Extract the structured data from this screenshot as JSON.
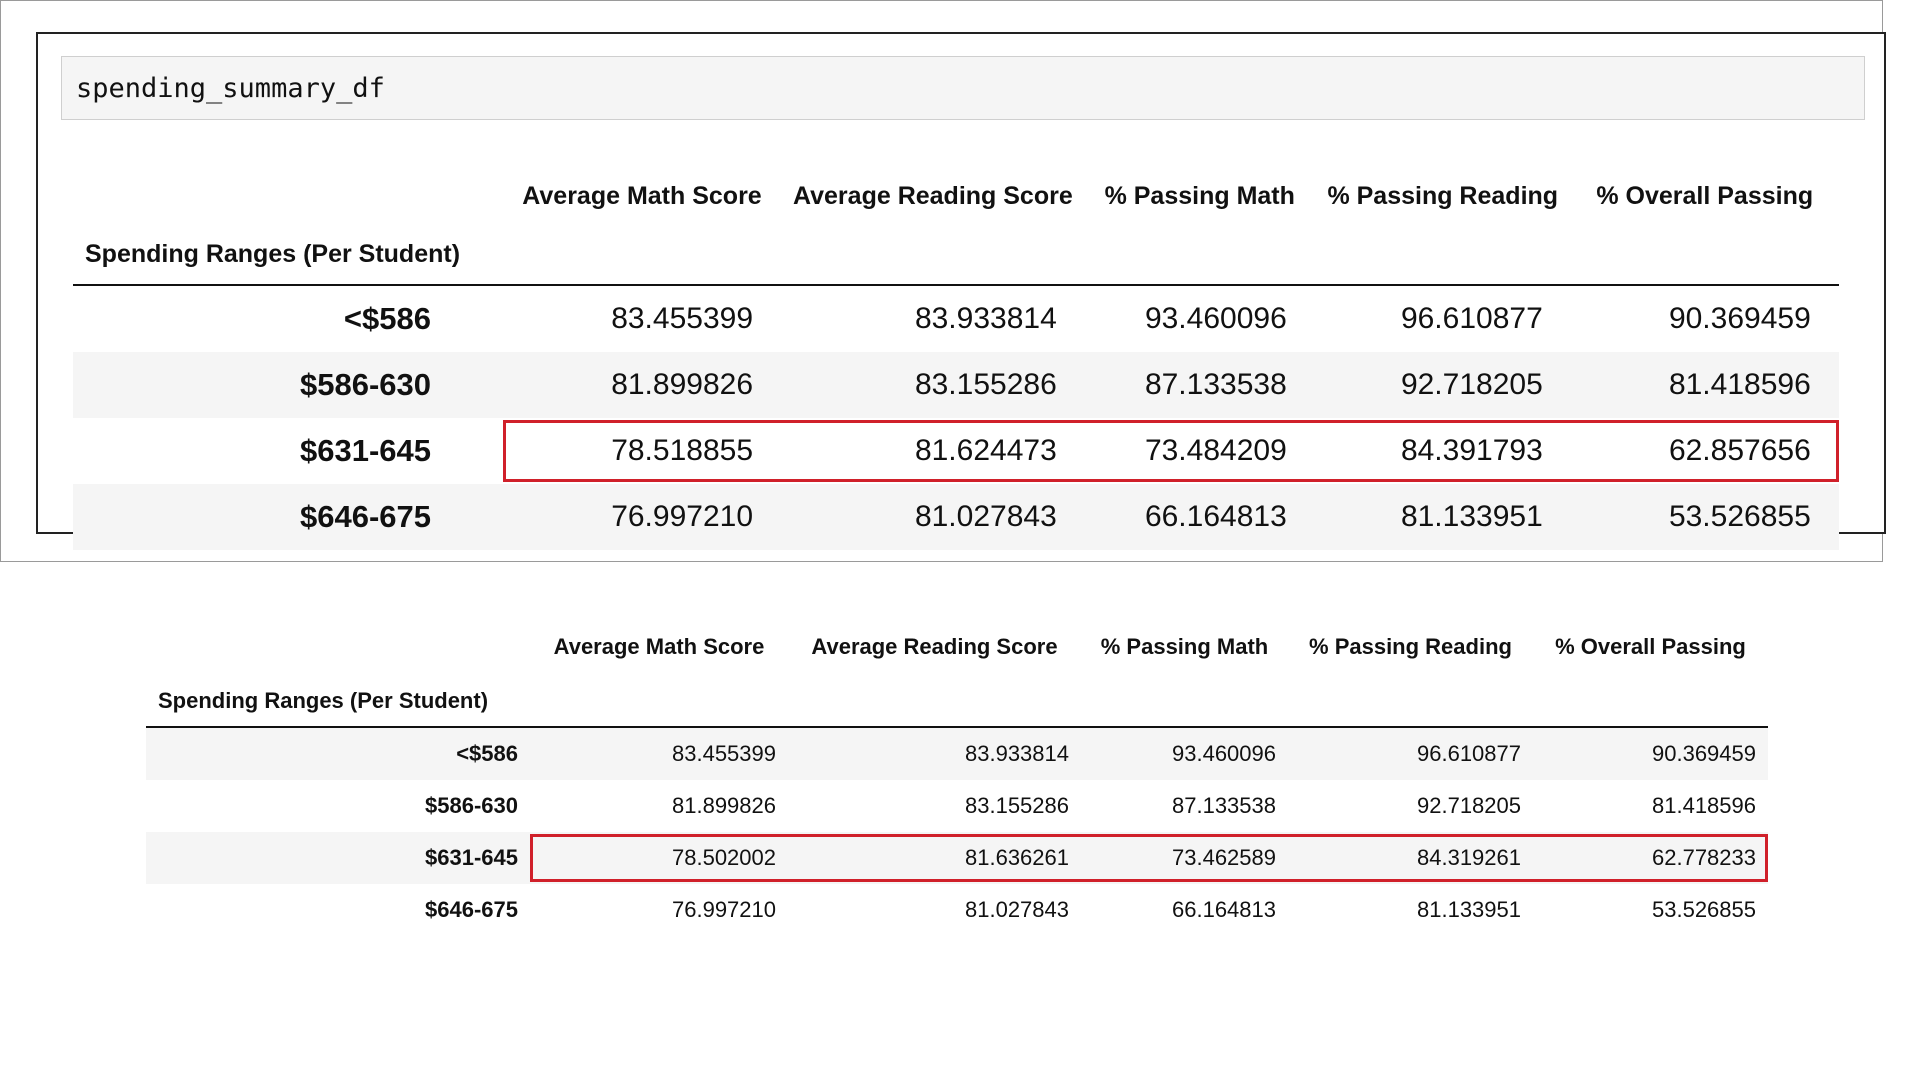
{
  "cell": {
    "code": "spending_summary_df"
  },
  "highlight_color": "#d0202a",
  "top_table": {
    "index_name": "Spending Ranges (Per Student)",
    "columns": [
      "Average Math Score",
      "Average Reading Score",
      "% Passing Math",
      "% Passing Reading",
      "% Overall Passing"
    ],
    "rows": [
      {
        "label": "<$586",
        "values": [
          "83.455399",
          "83.933814",
          "93.460096",
          "96.610877",
          "90.369459"
        ]
      },
      {
        "label": "$586-630",
        "values": [
          "81.899826",
          "83.155286",
          "87.133538",
          "92.718205",
          "81.418596"
        ]
      },
      {
        "label": "$631-645",
        "values": [
          "78.518855",
          "81.624473",
          "73.484209",
          "84.391793",
          "62.857656"
        ]
      },
      {
        "label": "$646-675",
        "values": [
          "76.997210",
          "81.027843",
          "66.164813",
          "81.133951",
          "53.526855"
        ]
      }
    ],
    "highlighted_row": 2
  },
  "bottom_table": {
    "index_name": "Spending Ranges (Per Student)",
    "columns": [
      "Average Math Score",
      "Average Reading Score",
      "% Passing Math",
      "% Passing Reading",
      "% Overall Passing"
    ],
    "rows": [
      {
        "label": "<$586",
        "values": [
          "83.455399",
          "83.933814",
          "93.460096",
          "96.610877",
          "90.369459"
        ]
      },
      {
        "label": "$586-630",
        "values": [
          "81.899826",
          "83.155286",
          "87.133538",
          "92.718205",
          "81.418596"
        ]
      },
      {
        "label": "$631-645",
        "values": [
          "78.502002",
          "81.636261",
          "73.462589",
          "84.319261",
          "62.778233"
        ]
      },
      {
        "label": "$646-675",
        "values": [
          "76.997210",
          "81.027843",
          "66.164813",
          "81.133951",
          "53.526855"
        ]
      }
    ],
    "highlighted_row": 2
  }
}
